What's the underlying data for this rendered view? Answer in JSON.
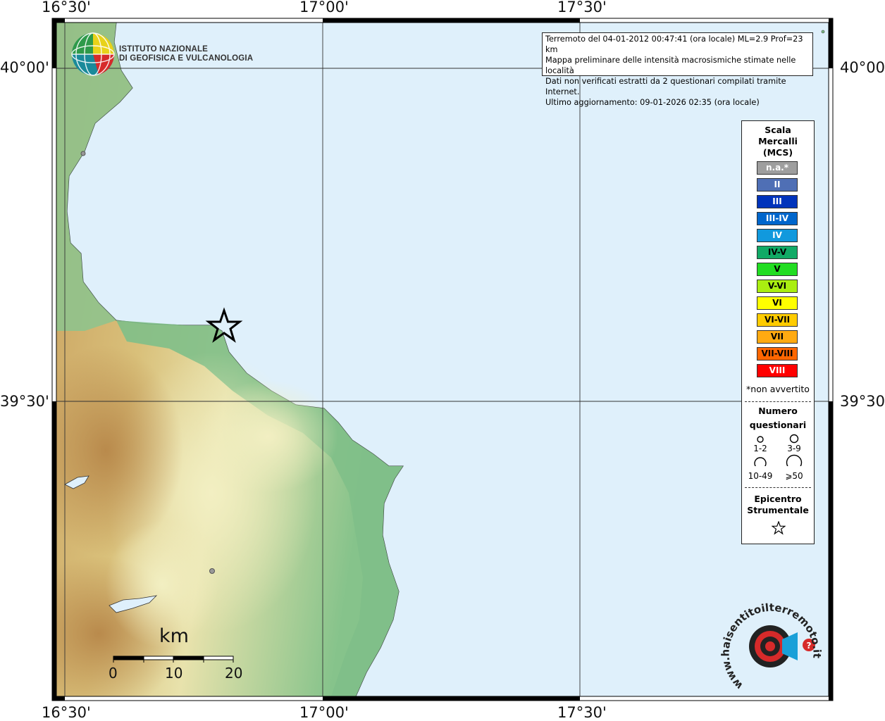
{
  "lon_labels": [
    "16°30'",
    "17°00'",
    "17°30'"
  ],
  "lat_labels": [
    "40°00'",
    "39°30'"
  ],
  "institute": {
    "line1": "ISTITUTO NAZIONALE",
    "line2": "DI GEOFISICA E VULCANOLOGIA"
  },
  "info": {
    "line1": "Terremoto del 04-01-2012 00:47:41 (ora locale) ML=2.9 Prof=23 km",
    "line2": "Mappa preliminare delle intensità macrosismiche stimate nelle località",
    "line3": "Dati non verificati estratti da 2 questionari compilati tramite Internet.",
    "line4": "Ultimo aggiornamento: 09-01-2026 02:35 (ora locale)"
  },
  "legend": {
    "title1": "Scala",
    "title2": "Mercalli",
    "title3": "(MCS)",
    "intensities": [
      {
        "label": "n.a.*",
        "color": "#9e9e9e",
        "text_color": "#ffffff"
      },
      {
        "label": "II",
        "color": "#4f6fb5",
        "text_color": "#ffffff"
      },
      {
        "label": "III",
        "color": "#0033bb",
        "text_color": "#ffffff"
      },
      {
        "label": "III-IV",
        "color": "#0066cc",
        "text_color": "#ffffff"
      },
      {
        "label": "IV",
        "color": "#1199dd",
        "text_color": "#ffffff"
      },
      {
        "label": "IV-V",
        "color": "#11aa66",
        "text_color": "#000000"
      },
      {
        "label": "V",
        "color": "#22dd22",
        "text_color": "#000000"
      },
      {
        "label": "V-VI",
        "color": "#aaee11",
        "text_color": "#000000"
      },
      {
        "label": "VI",
        "color": "#ffff00",
        "text_color": "#000000"
      },
      {
        "label": "VI-VII",
        "color": "#ffcc00",
        "text_color": "#000000"
      },
      {
        "label": "VII",
        "color": "#ffaa11",
        "text_color": "#000000"
      },
      {
        "label": "VII-VIII",
        "color": "#ff6600",
        "text_color": "#000000"
      },
      {
        "label": "VIII",
        "color": "#ff0000",
        "text_color": "#ffffff"
      }
    ],
    "not_felt_note": "*non avvertito",
    "count_title1": "Numero",
    "count_title2": "questionari",
    "count_1": "1-2",
    "count_2": "3-9",
    "count_3": "10-49",
    "count_4": "⩾50",
    "epicenter_title1": "Epicentro",
    "epicenter_title2": "Strumentale"
  },
  "scalebar": {
    "unit": "km",
    "ticks": [
      "0",
      "10",
      "20"
    ]
  },
  "watermark": {
    "text": "www.haisentitoilterremoto.it"
  },
  "colors": {
    "sea": "#dff0fb",
    "lowland": "#7fbf88",
    "hills": "#e9e5b0",
    "mountains": "#c49a5a",
    "frame": "#000000"
  }
}
